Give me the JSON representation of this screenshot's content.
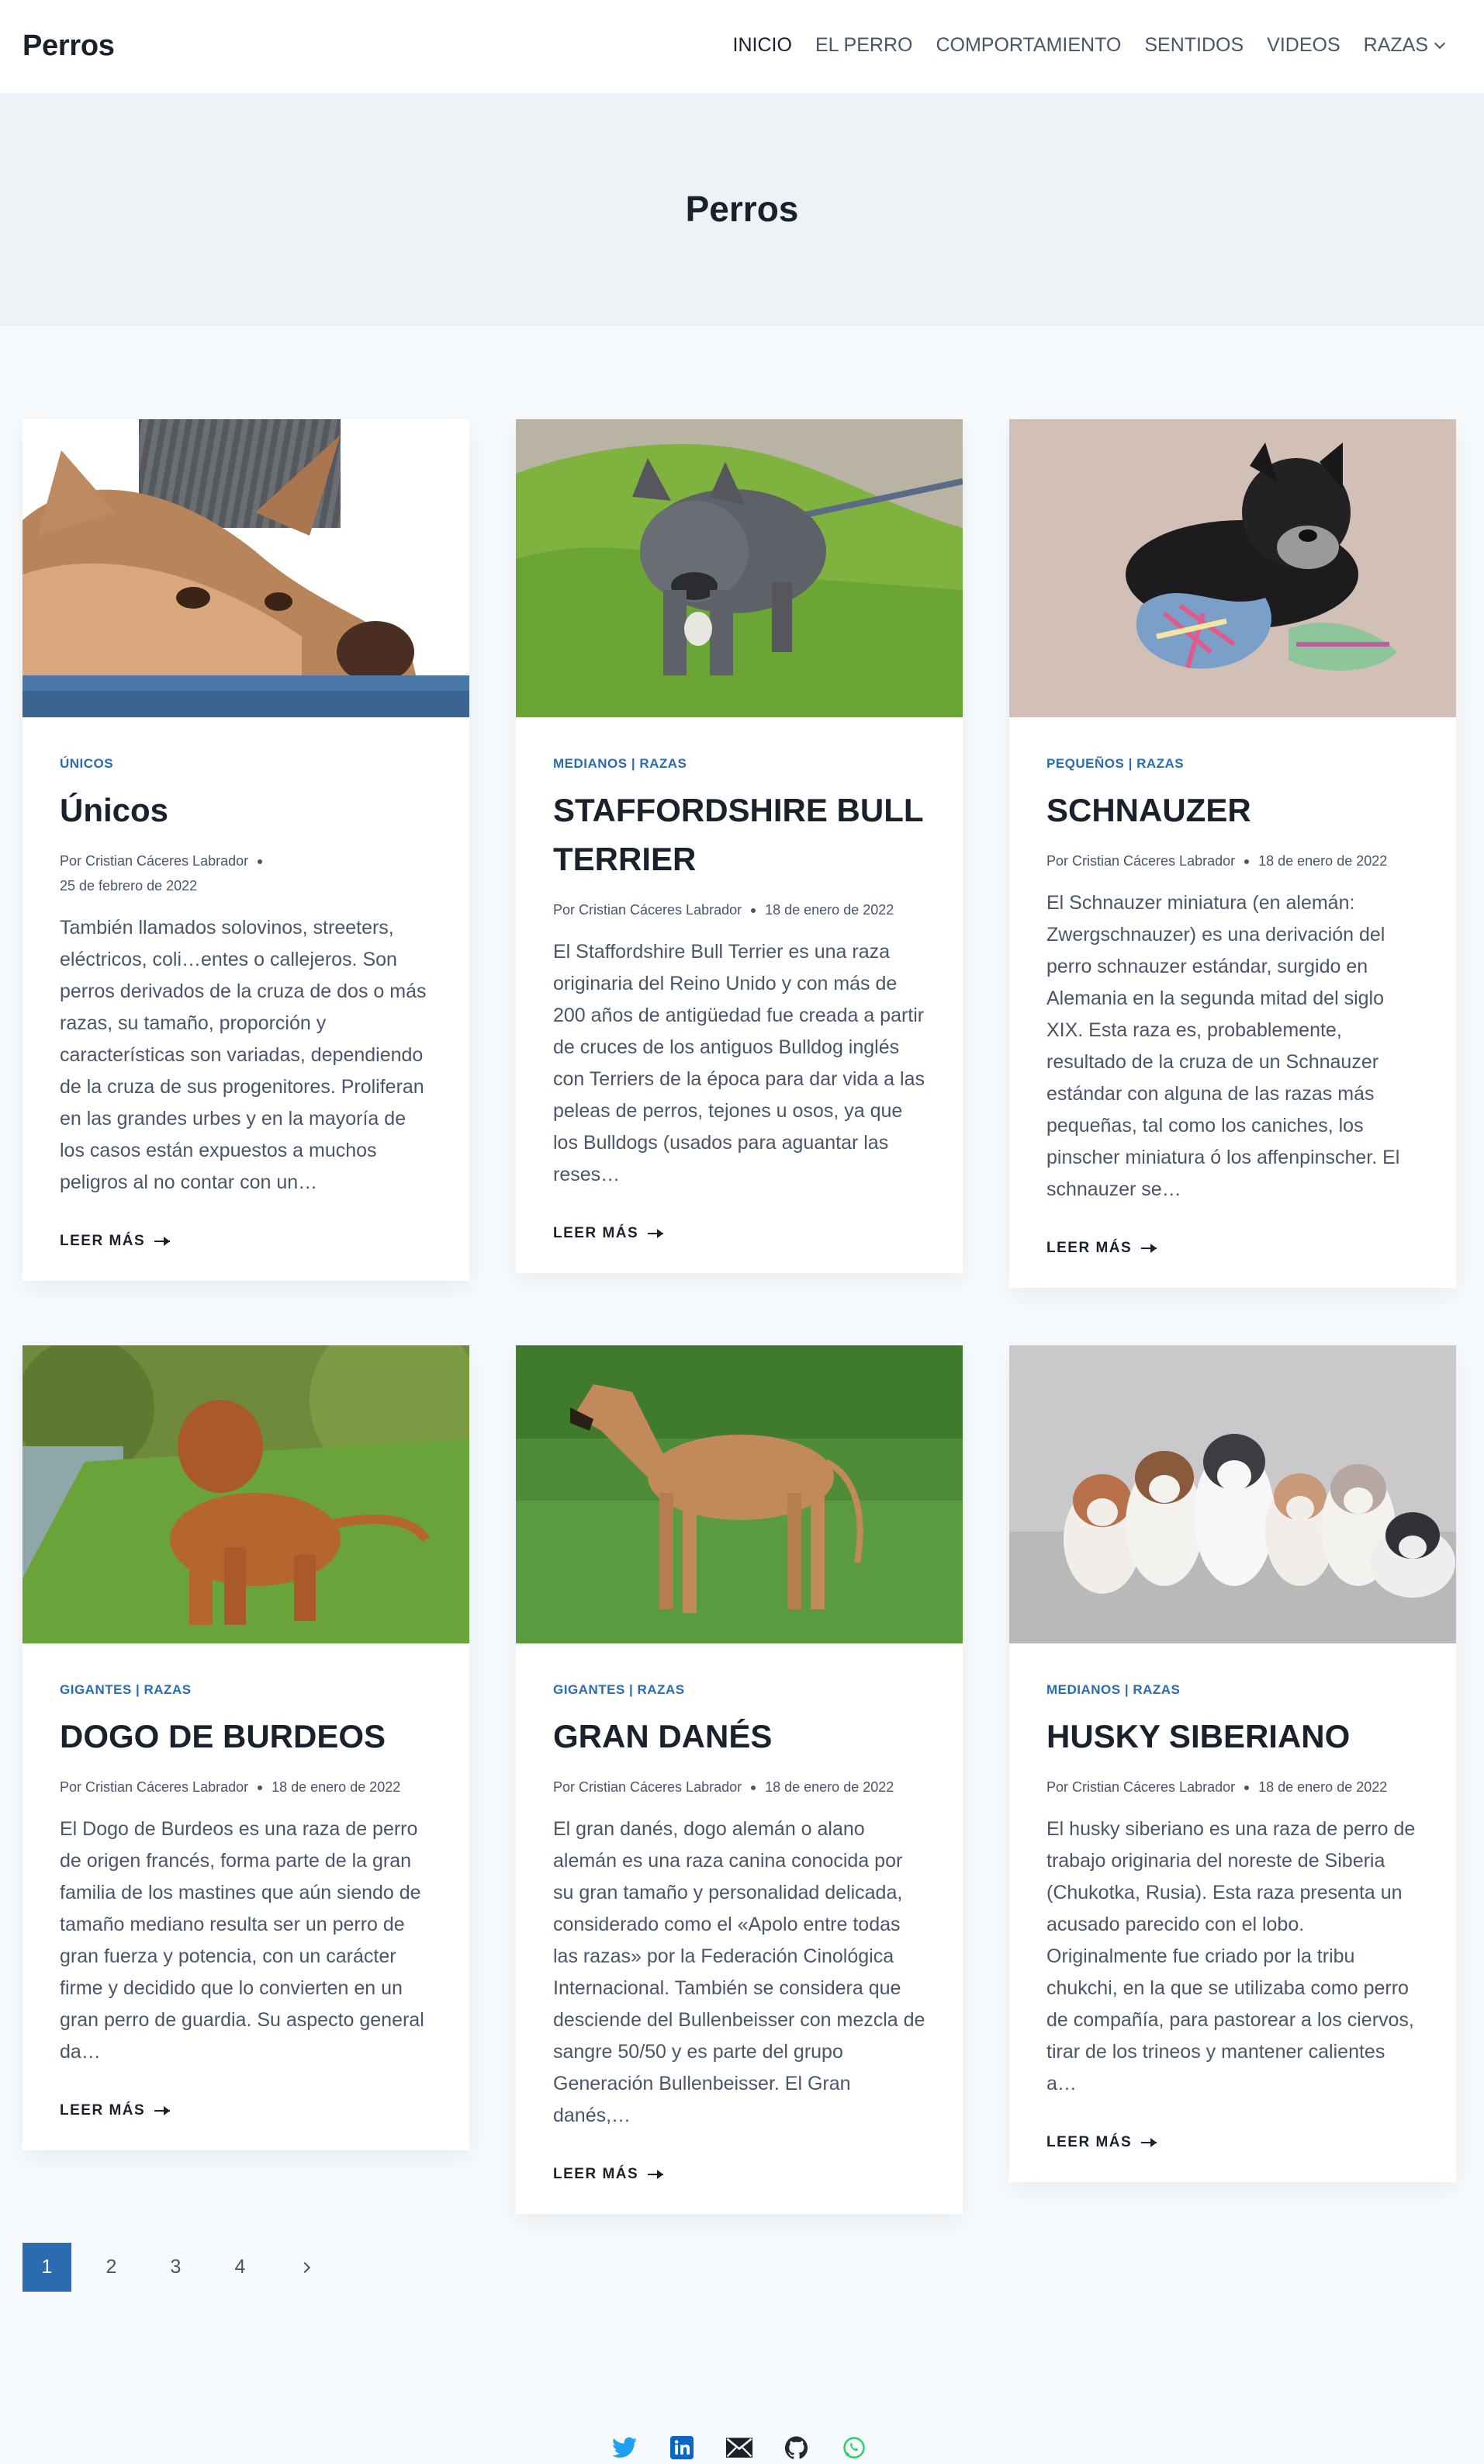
{
  "site": {
    "logo": "Perros"
  },
  "nav": [
    {
      "label": "INICIO",
      "active": true
    },
    {
      "label": "EL PERRO"
    },
    {
      "label": "COMPORTAMIENTO"
    },
    {
      "label": "SENTIDOS"
    },
    {
      "label": "VIDEOS"
    },
    {
      "label": "RAZAS",
      "has_dropdown": true
    }
  ],
  "hero": {
    "title": "Perros"
  },
  "posts": [
    {
      "categories": [
        "ÚNICOS"
      ],
      "title": "Únicos",
      "author": "Por Cristian Cáceres Labrador",
      "date": "25 de febrero de 2022",
      "excerpt": "También llamados solovinos, streeters, eléctricos, coli…entes o callejeros. Son perros derivados de la cruza de dos o más razas, su tamaño, proporción y características son variadas, dependiendo de la cruza de sus progenitores. Proliferan en las grandes urbes y en la mayoría de los casos están expuestos a muchos peligros al no contar con un…",
      "more": "LEER MÁS"
    },
    {
      "categories": [
        "MEDIANOS",
        "RAZAS"
      ],
      "title": "STAFFORDSHIRE BULL TERRIER",
      "author": "Por Cristian Cáceres Labrador",
      "date": "18 de enero de 2022",
      "excerpt": "El Staffordshire Bull Terrier es una raza originaria del Reino Unido y con más de 200 años de antigüedad fue creada a partir de cruces de los antiguos Bulldog inglés con Terriers de la época para dar vida a las peleas de perros, tejones u osos, ya que los Bulldogs (usados para aguantar las reses…",
      "more": "LEER MÁS"
    },
    {
      "categories": [
        "PEQUEÑOS",
        "RAZAS"
      ],
      "title": "SCHNAUZER",
      "author": "Por Cristian Cáceres Labrador",
      "date": "18 de enero de 2022",
      "excerpt": "El Schnauzer miniatura (en alemán: Zwergschnauzer) es una derivación del perro schnauzer estándar, surgido en Alemania en la segunda mitad del siglo XIX. Esta raza es, probablemente, resultado de la cruza de un Schnauzer estándar con alguna de las razas más pequeñas, tal como los caniches, los pinscher miniatura ó los affenpinscher. El schnauzer se…",
      "more": "LEER MÁS"
    },
    {
      "categories": [
        "GIGANTES",
        "RAZAS"
      ],
      "title": "DOGO DE BURDEOS",
      "author": "Por Cristian Cáceres Labrador",
      "date": "18 de enero de 2022",
      "excerpt": "El Dogo de Burdeos es una raza de perro de origen francés, forma parte de la gran familia de los mastines que aún siendo de tamaño mediano resulta ser un perro de gran fuerza y potencia, con un carácter firme y decidido que lo convierten en un gran perro de guardia. Su aspecto general da…",
      "more": "LEER MÁS"
    },
    {
      "categories": [
        "GIGANTES",
        "RAZAS"
      ],
      "title": "GRAN DANÉS",
      "author": "Por Cristian Cáceres Labrador",
      "date": "18 de enero de 2022",
      "excerpt": "El gran danés, dogo alemán o alano alemán es una raza canina conocida por su gran tamaño y personalidad delicada, considerado como el «Apolo entre todas las razas» por la Federación Cinológica Internacional. También se considera que desciende del Bullenbeisser con mezcla de sangre 50/50 y es parte del grupo Generación Bullenbeisser. El Gran danés,…",
      "more": "LEER MÁS"
    },
    {
      "categories": [
        "MEDIANOS",
        "RAZAS"
      ],
      "title": "HUSKY SIBERIANO",
      "author": "Por Cristian Cáceres Labrador",
      "date": "18 de enero de 2022",
      "excerpt": "El husky siberiano es una raza de perro de trabajo originaria del noreste de Siberia (Chukotka, Rusia). Esta raza presenta un acusado parecido con el lobo. Originalmente fue criado por la tribu chukchi, en la que se utilizaba como perro de compañía, para pastorear a los ciervos, tirar de los trineos y mantener calientes a…",
      "more": "LEER MÁS"
    }
  ],
  "pagination": {
    "pages": [
      "1",
      "2",
      "3",
      "4"
    ],
    "current": "1"
  },
  "social": [
    {
      "icon": "twitter-icon",
      "color": "#1da1f2"
    },
    {
      "icon": "linkedin-icon",
      "color": "#0a66c2"
    },
    {
      "icon": "email-icon",
      "color": "#1a202c"
    },
    {
      "icon": "github-icon",
      "color": "#24292e"
    },
    {
      "icon": "whatsapp-icon",
      "color": "#25d366"
    }
  ],
  "colors": {
    "accent": "#2b6cb0",
    "hero_bg": "#edf2f7",
    "page_bg": "#f7fafc"
  }
}
